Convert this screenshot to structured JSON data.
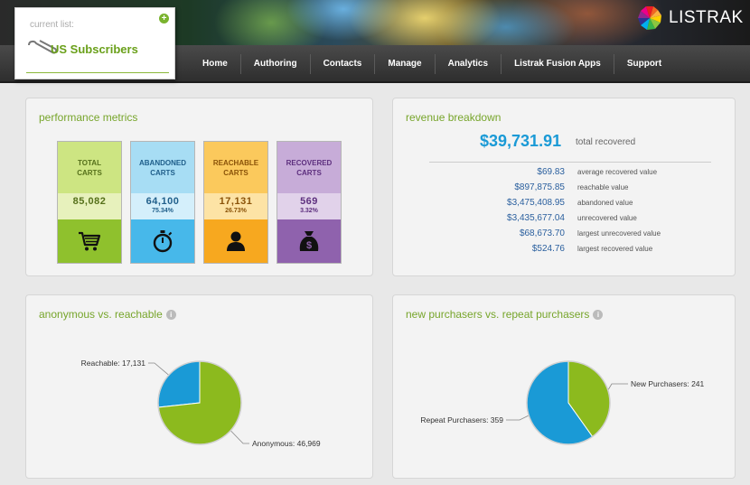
{
  "current_list": {
    "label": "current list:",
    "name": "US Subscribers"
  },
  "brand": {
    "name": "LISTRAK"
  },
  "nav": [
    {
      "label": "Home"
    },
    {
      "label": "Authoring"
    },
    {
      "label": "Contacts"
    },
    {
      "label": "Manage"
    },
    {
      "label": "Analytics"
    },
    {
      "label": "Listrak Fusion Apps"
    },
    {
      "label": "Support"
    }
  ],
  "performance": {
    "title": "performance metrics",
    "metrics": [
      {
        "label": "TOTAL\nCARTS",
        "value": "85,082",
        "pct": "",
        "icon": "shopping-cart-icon",
        "colors": {
          "head": "#cde582",
          "val": "#e7f1bc",
          "ico": "#8fc12d",
          "text": "#55701a"
        }
      },
      {
        "label": "ABANDONED\nCARTS",
        "value": "64,100",
        "pct": "75.34%",
        "icon": "stopwatch-icon",
        "colors": {
          "head": "#a7ddf4",
          "val": "#d4effb",
          "ico": "#47b8ea",
          "text": "#1f5e8a"
        }
      },
      {
        "label": "REACHABLE\nCARTS",
        "value": "17,131",
        "pct": "26.73%",
        "icon": "person-icon",
        "colors": {
          "head": "#fbc95c",
          "val": "#fde3a5",
          "ico": "#f7a81f",
          "text": "#8a5208"
        }
      },
      {
        "label": "RECOVERED\nCARTS",
        "value": "569",
        "pct": "3.32%",
        "icon": "money-bag-icon",
        "colors": {
          "head": "#c7acd8",
          "val": "#e1d2ea",
          "ico": "#8f62ad",
          "text": "#5d2f7e"
        }
      }
    ]
  },
  "revenue": {
    "title": "revenue breakdown",
    "total": "$39,731.91",
    "total_label": "total recovered",
    "rows": [
      {
        "value": "$69.83",
        "label": "average recovered value"
      },
      {
        "value": "$897,875.85",
        "label": "reachable value"
      },
      {
        "value": "$3,475,408.95",
        "label": "abandoned value"
      },
      {
        "value": "$3,435,677.04",
        "label": "unrecovered value"
      },
      {
        "value": "$68,673.70",
        "label": "largest unrecovered value"
      },
      {
        "value": "$524.76",
        "label": "largest recovered value"
      }
    ]
  },
  "anon_chart": {
    "title": "anonymous vs. reachable",
    "chart_data": {
      "type": "pie",
      "slices": [
        {
          "label": "Reachable: 17,131",
          "value": 17131,
          "color": "#1a9ad6"
        },
        {
          "label": "Anonymous: 46,969",
          "value": 46969,
          "color": "#8cba1e"
        }
      ]
    }
  },
  "purchasers_chart": {
    "title": "new purchasers vs. repeat purchasers",
    "chart_data": {
      "type": "pie",
      "slices": [
        {
          "label": "New Purchasers: 241",
          "value": 241,
          "color": "#8cba1e"
        },
        {
          "label": "Repeat Purchasers: 359",
          "value": 359,
          "color": "#1a9ad6"
        }
      ]
    }
  }
}
